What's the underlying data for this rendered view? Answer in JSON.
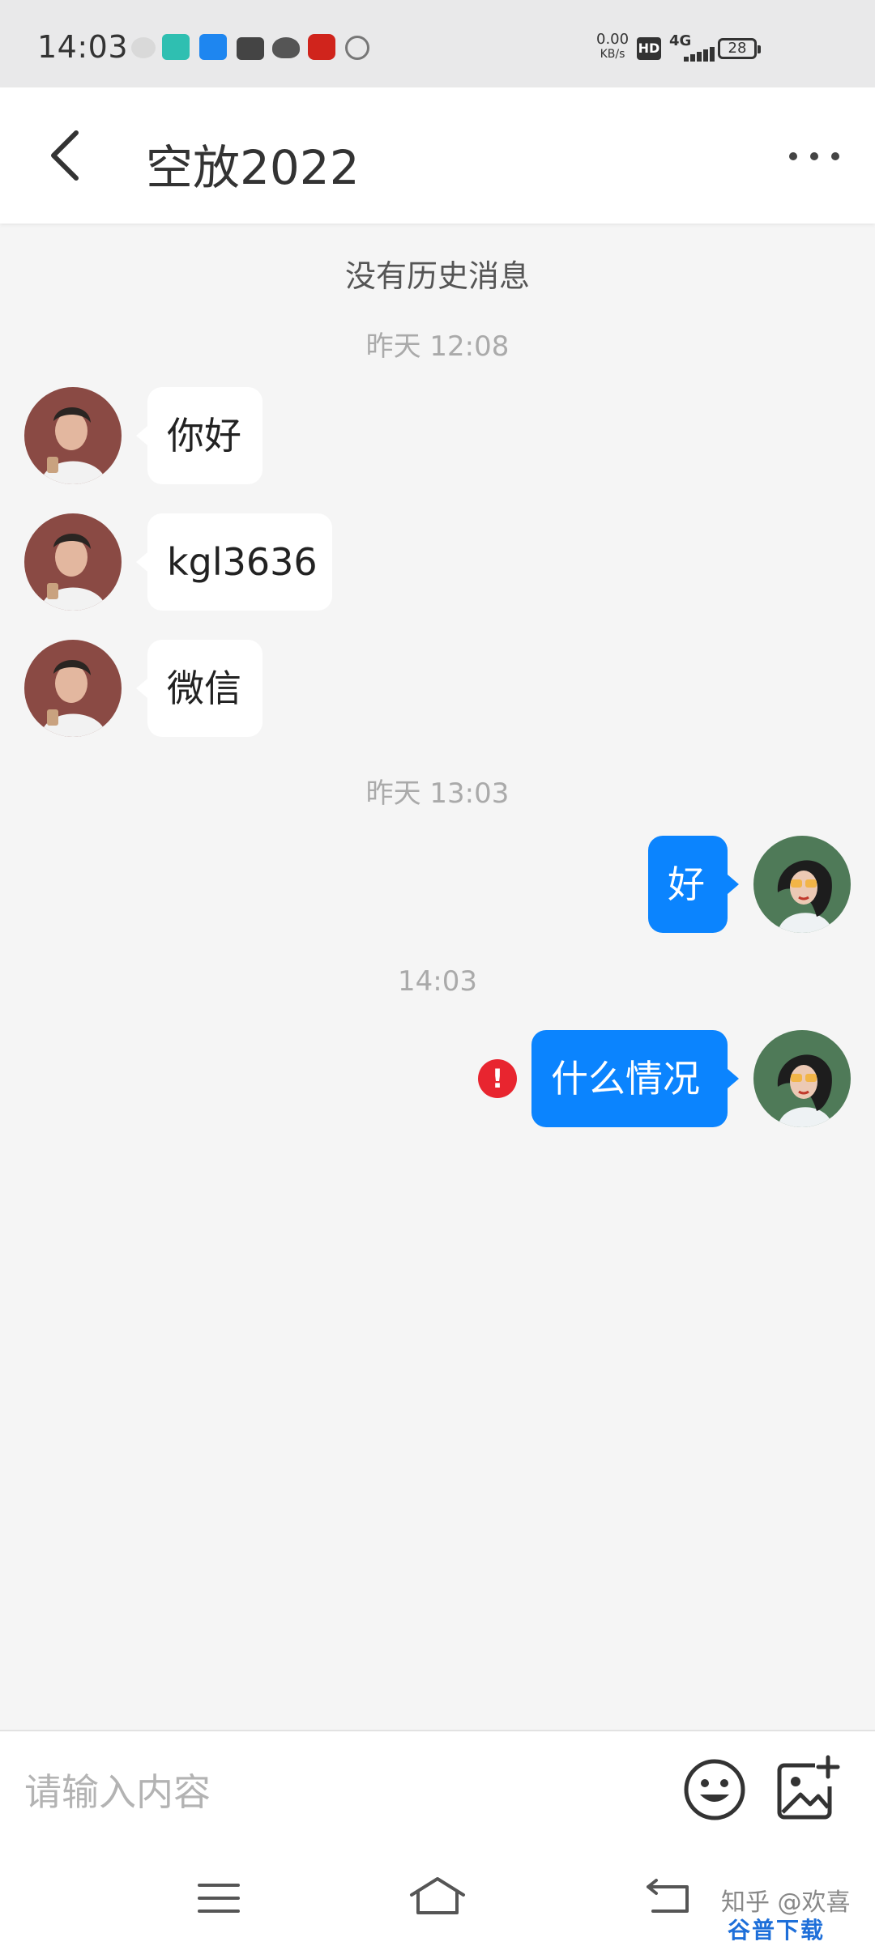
{
  "status_bar": {
    "time": "14:03",
    "net_speed_value": "0.00",
    "net_speed_unit": "KB/s",
    "hd_label": "HD",
    "network_label": "4G",
    "battery": "28",
    "app_icons": [
      "wechat-icon",
      "boss-icon",
      "zhihu-icon",
      "calendar-icon",
      "cow-icon",
      "ctrip-icon",
      "hotspot-icon"
    ]
  },
  "header": {
    "title": "空放2022"
  },
  "conversation": {
    "no_history": "没有历史消息",
    "timestamps": [
      "昨天 12:08",
      "昨天 13:03",
      "14:03"
    ],
    "messages": [
      {
        "text": "你好",
        "direction": "incoming"
      },
      {
        "text": "kgl3636",
        "direction": "incoming"
      },
      {
        "text": "微信",
        "direction": "incoming"
      },
      {
        "text": "好",
        "direction": "outgoing"
      },
      {
        "text": "什么情况",
        "direction": "outgoing",
        "status": "send-failed"
      }
    ],
    "error_glyph": "!"
  },
  "input": {
    "placeholder": "请输入内容",
    "value": ""
  },
  "watermark": {
    "text": "知乎 @欢喜",
    "logo": "谷普下载"
  },
  "colors": {
    "accent": "#0b84fe",
    "error": "#e8252f",
    "background": "#f5f5f5"
  }
}
